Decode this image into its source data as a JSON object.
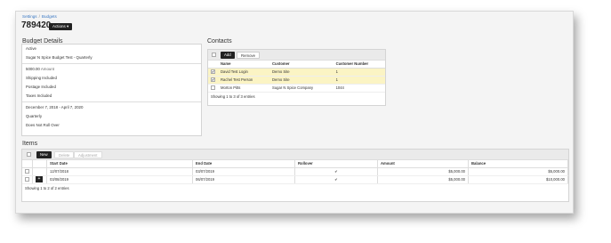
{
  "breadcrumb": {
    "parent": "Settings",
    "current": "Budgets"
  },
  "record_id": "789420",
  "actions_label": "Actions ▾",
  "budget_details": {
    "title": "Budget Details",
    "status": "Active",
    "name": "Sugar N Spice Budget Test - Quarterly",
    "amount": "5000.00",
    "amount_label": "Amount",
    "shipping": "Shipping Included",
    "postage": "Postage Included",
    "taxes": "Taxes Included",
    "date_range": "December 7, 2018 - April 7, 2020",
    "frequency": "Quarterly",
    "rollover": "Does Not Roll Over"
  },
  "contacts": {
    "title": "Contacts",
    "add_label": "Add",
    "remove_label": "Remove",
    "columns": [
      "Name",
      "Customer",
      "Customer Number"
    ],
    "rows": [
      {
        "name": "David Test Login",
        "customer": "Demo Site",
        "number": "1",
        "checked": true
      },
      {
        "name": "Rachel Test Person",
        "customer": "Demo Site",
        "number": "1",
        "checked": true
      },
      {
        "name": "Morton Pitts",
        "customer": "Sugar N Spice Company",
        "number": "1044",
        "checked": false
      }
    ],
    "footer": "Showing 1 to 3 of 3 entries"
  },
  "items": {
    "title": "Items",
    "new_label": "New",
    "delete_label": "Delete",
    "adjustment_label": "Adjustment",
    "columns": [
      "Start Date",
      "End Date",
      "Rollover",
      "Amount",
      "Balance"
    ],
    "rows": [
      {
        "start": "12/07/2018",
        "end": "03/07/2019",
        "rollover": "✔",
        "amount": "$5,000.00",
        "balance": "$5,000.00"
      },
      {
        "start": "03/08/2019",
        "end": "06/07/2019",
        "rollover": "✔",
        "amount": "$5,000.00",
        "balance": "$10,000.00"
      }
    ],
    "footer": "Showing 1 to 2 of 2 entries"
  }
}
